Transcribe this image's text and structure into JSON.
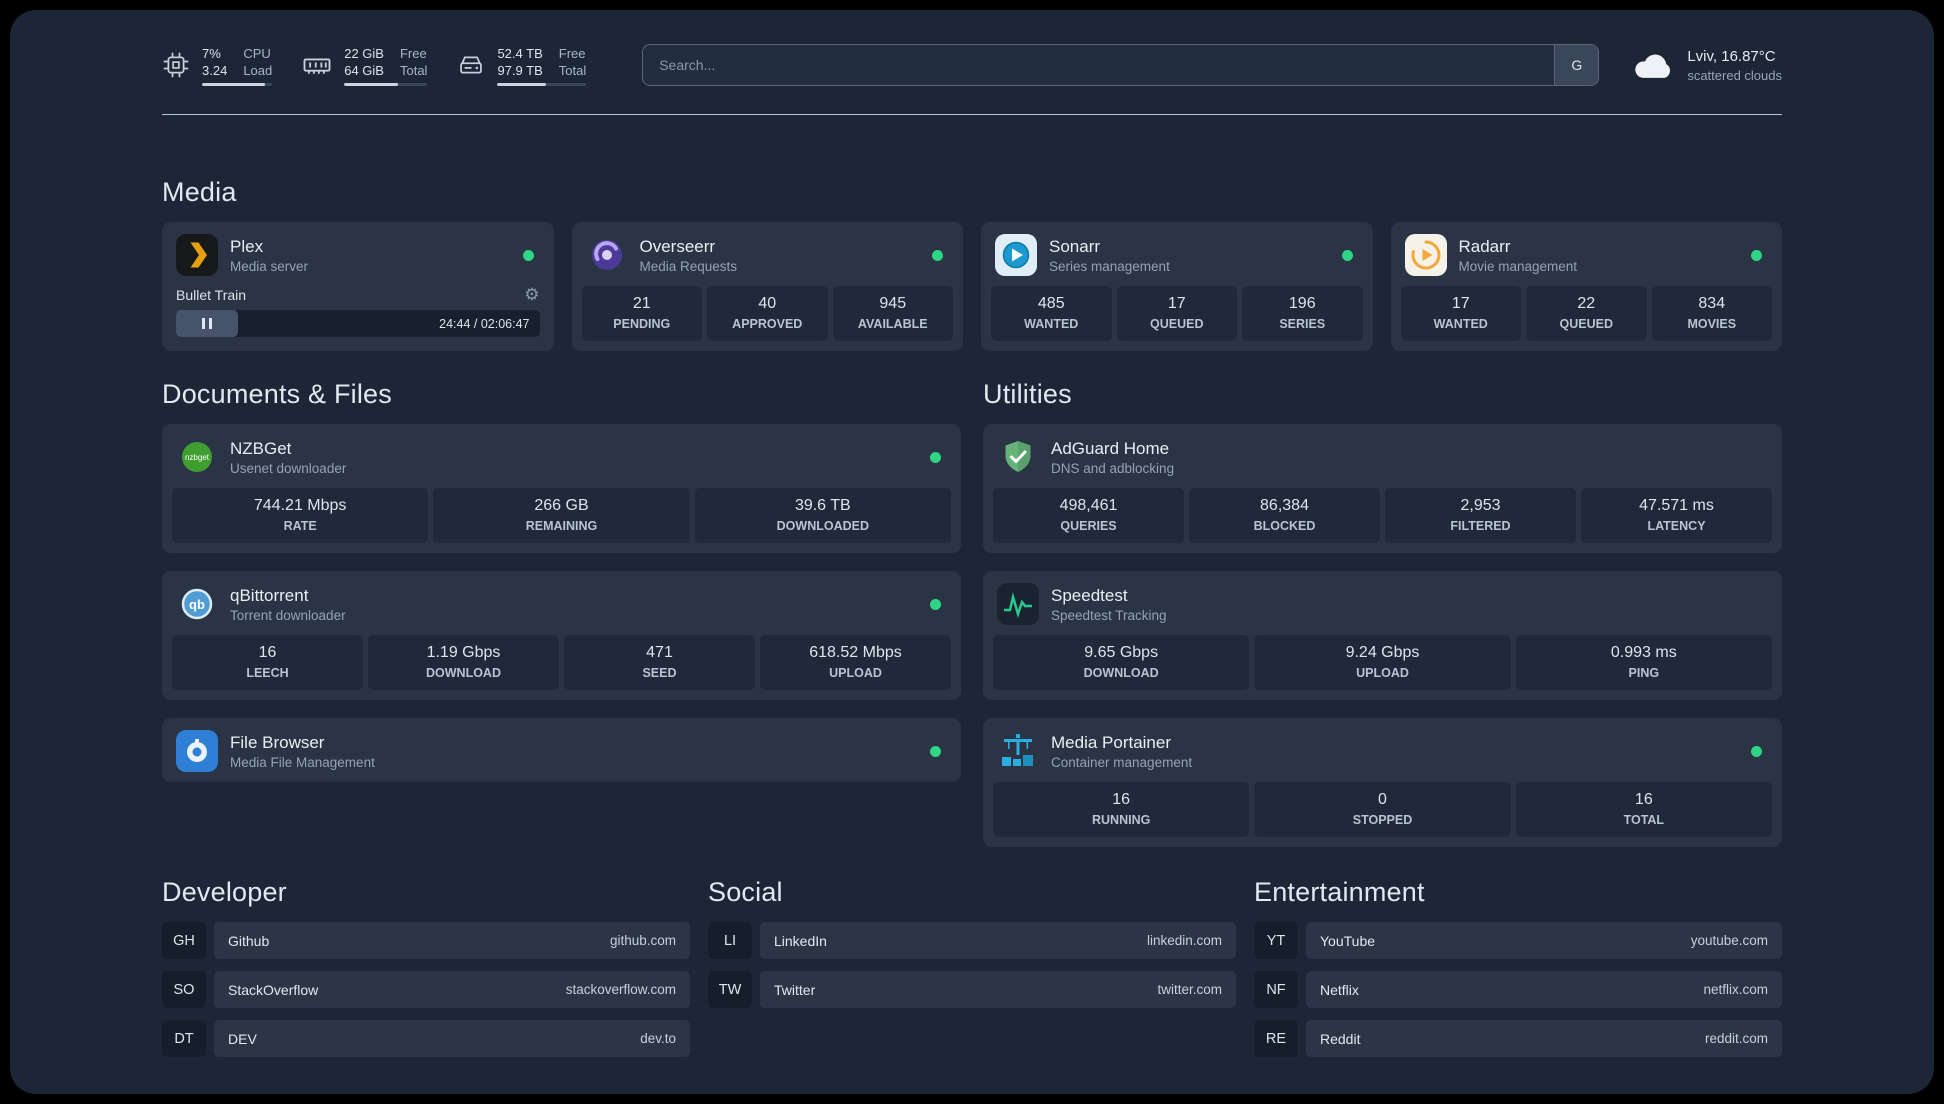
{
  "topbar": {
    "resources": [
      {
        "name": "cpu",
        "value_top": "7%",
        "value_bottom": "3.24",
        "label_top": "CPU",
        "label_bottom": "Load",
        "progress_pct": 90
      },
      {
        "name": "memory",
        "value_top": "22 GiB",
        "value_bottom": "64 GiB",
        "label_top": "Free",
        "label_bottom": "Total",
        "progress_pct": 65
      },
      {
        "name": "disk",
        "value_top": "52.4 TB",
        "value_bottom": "97.9 TB",
        "label_top": "Free",
        "label_bottom": "Total",
        "progress_pct": 55
      }
    ],
    "search": {
      "placeholder": "Search...",
      "button_label": "G"
    },
    "weather": {
      "location": "Lviv, 16.87°C",
      "condition": "scattered clouds"
    }
  },
  "media": {
    "title": "Media",
    "cards": [
      {
        "name": "Plex",
        "desc": "Media server",
        "online": true,
        "player": {
          "track": "Bullet Train",
          "time": "24:44 / 02:06:47",
          "progress_pct": 17,
          "gear_icon": "⚙"
        }
      },
      {
        "name": "Overseerr",
        "desc": "Media Requests",
        "online": true,
        "stats": [
          {
            "value": "21",
            "label": "PENDING"
          },
          {
            "value": "40",
            "label": "APPROVED"
          },
          {
            "value": "945",
            "label": "AVAILABLE"
          }
        ]
      },
      {
        "name": "Sonarr",
        "desc": "Series management",
        "online": true,
        "stats": [
          {
            "value": "485",
            "label": "WANTED"
          },
          {
            "value": "17",
            "label": "QUEUED"
          },
          {
            "value": "196",
            "label": "SERIES"
          }
        ]
      },
      {
        "name": "Radarr",
        "desc": "Movie management",
        "online": true,
        "stats": [
          {
            "value": "17",
            "label": "WANTED"
          },
          {
            "value": "22",
            "label": "QUEUED"
          },
          {
            "value": "834",
            "label": "MOVIES"
          }
        ]
      }
    ]
  },
  "documents": {
    "title": "Documents & Files",
    "cards": [
      {
        "name": "NZBGet",
        "desc": "Usenet downloader",
        "online": true,
        "stats": [
          {
            "value": "744.21 Mbps",
            "label": "RATE"
          },
          {
            "value": "266 GB",
            "label": "REMAINING"
          },
          {
            "value": "39.6 TB",
            "label": "DOWNLOADED"
          }
        ]
      },
      {
        "name": "qBittorrent",
        "desc": "Torrent downloader",
        "online": true,
        "stats": [
          {
            "value": "16",
            "label": "LEECH"
          },
          {
            "value": "1.19 Gbps",
            "label": "DOWNLOAD"
          },
          {
            "value": "471",
            "label": "SEED"
          },
          {
            "value": "618.52 Mbps",
            "label": "UPLOAD"
          }
        ]
      },
      {
        "name": "File Browser",
        "desc": "Media File Management",
        "online": true,
        "stats": []
      }
    ]
  },
  "utilities": {
    "title": "Utilities",
    "cards": [
      {
        "name": "AdGuard Home",
        "desc": "DNS and adblocking",
        "stats": [
          {
            "value": "498,461",
            "label": "QUERIES"
          },
          {
            "value": "86,384",
            "label": "BLOCKED"
          },
          {
            "value": "2,953",
            "label": "FILTERED"
          },
          {
            "value": "47.571 ms",
            "label": "LATENCY"
          }
        ]
      },
      {
        "name": "Speedtest",
        "desc": "Speedtest Tracking",
        "stats": [
          {
            "value": "9.65 Gbps",
            "label": "DOWNLOAD"
          },
          {
            "value": "9.24 Gbps",
            "label": "UPLOAD"
          },
          {
            "value": "0.993 ms",
            "label": "PING"
          }
        ]
      },
      {
        "name": "Media Portainer",
        "desc": "Container management",
        "online": true,
        "stats": [
          {
            "value": "16",
            "label": "RUNNING"
          },
          {
            "value": "0",
            "label": "STOPPED"
          },
          {
            "value": "16",
            "label": "TOTAL"
          }
        ]
      }
    ]
  },
  "bookmarks": {
    "groups": [
      {
        "title": "Developer",
        "items": [
          {
            "abbr": "GH",
            "name": "Github",
            "url": "github.com"
          },
          {
            "abbr": "SO",
            "name": "StackOverflow",
            "url": "stackoverflow.com"
          },
          {
            "abbr": "DT",
            "name": "DEV",
            "url": "dev.to"
          }
        ]
      },
      {
        "title": "Social",
        "items": [
          {
            "abbr": "LI",
            "name": "LinkedIn",
            "url": "linkedin.com"
          },
          {
            "abbr": "TW",
            "name": "Twitter",
            "url": "twitter.com"
          }
        ]
      },
      {
        "title": "Entertainment",
        "items": [
          {
            "abbr": "YT",
            "name": "YouTube",
            "url": "youtube.com"
          },
          {
            "abbr": "NF",
            "name": "Netflix",
            "url": "netflix.com"
          },
          {
            "abbr": "RE",
            "name": "Reddit",
            "url": "reddit.com"
          }
        ]
      }
    ]
  },
  "colors": {
    "panel": "#1c2636",
    "card": "#2a3444",
    "tile": "#1f2939",
    "status_online": "#2dd584"
  }
}
